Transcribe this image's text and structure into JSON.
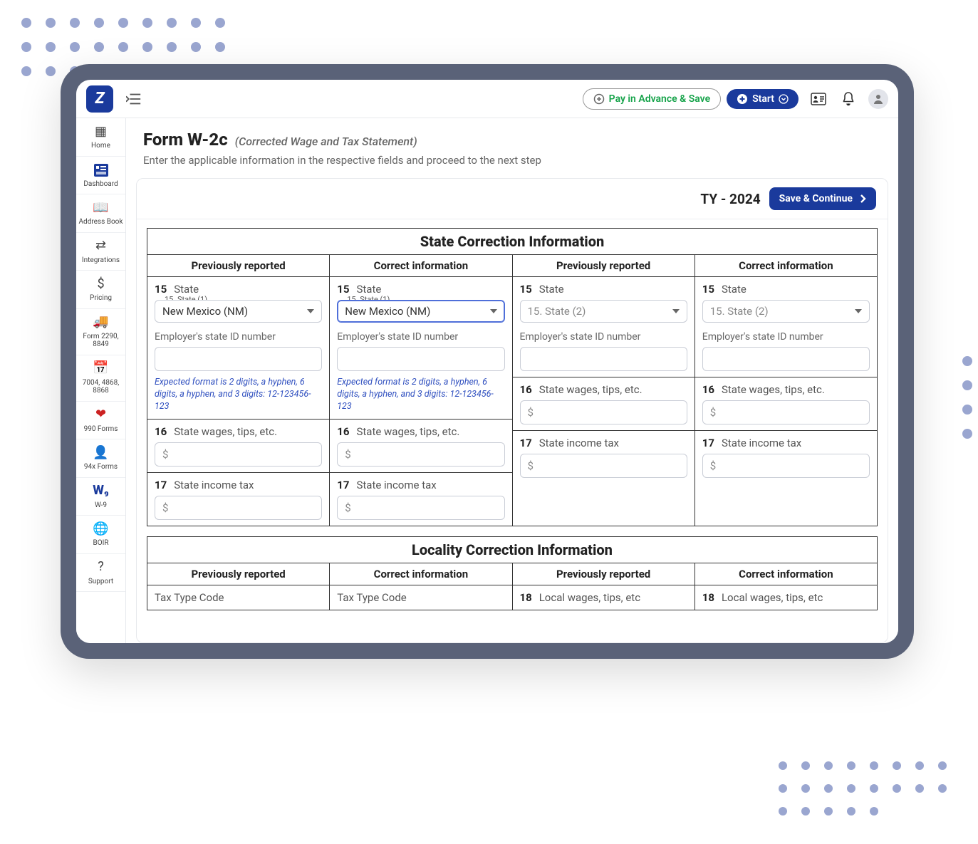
{
  "header": {
    "pay_label": "Pay in Advance & Save",
    "start_label": "Start"
  },
  "sidebar": {
    "items": [
      {
        "label": "Home"
      },
      {
        "label": "Dashboard"
      },
      {
        "label": "Address Book"
      },
      {
        "label": "Integrations"
      },
      {
        "label": "Pricing"
      },
      {
        "label": "Form 2290, 8849"
      },
      {
        "label": "7004, 4868, 8868"
      },
      {
        "label": "990 Forms"
      },
      {
        "label": "94x Forms"
      },
      {
        "label": "W-9"
      },
      {
        "label": "BOIR"
      },
      {
        "label": "Support"
      }
    ]
  },
  "page": {
    "title": "Form W-2c",
    "subtitle": "(Corrected Wage and Tax Statement)",
    "description": "Enter the applicable information in the respective fields and proceed to the next step",
    "tax_year": "TY - 2024",
    "save_label": "Save & Continue"
  },
  "form": {
    "state_section_title": "State Correction Information",
    "locality_section_title": "Locality Correction Information",
    "col_prev": "Previously reported",
    "col_correct": "Correct information",
    "row15_num": "15",
    "row15_label": "State",
    "state1_legend": "15. State (1)",
    "state2_placeholder": "15. State (2)",
    "state1_value": "New Mexico (NM)",
    "ein_label": "Employer's state ID number",
    "ein_format_hint": "Expected format is 2 digits, a hyphen, 6 digits, a hyphen, and 3 digits: 12-123456-123",
    "row16_num": "16",
    "row16_label": "State wages, tips, etc.",
    "row17_num": "17",
    "row17_label": "State income tax",
    "tax_type_label": "Tax Type Code",
    "row18_num": "18",
    "row18_label": "Local wages, tips, etc"
  }
}
